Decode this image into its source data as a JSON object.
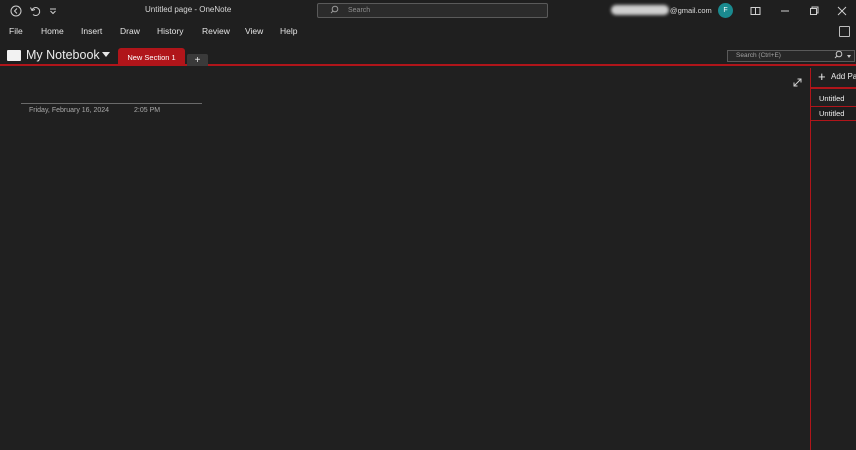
{
  "window": {
    "title": "Untitled page  -  OneNote",
    "search_placeholder": "Search",
    "account_suffix": "@gmail.com",
    "avatar_initial": "F",
    "icons": [
      "back-icon",
      "undo-icon",
      "quick-access-icon",
      "search-icon",
      "reading-mode-icon",
      "minimize-icon",
      "restore-icon",
      "close-icon"
    ]
  },
  "menu": {
    "items": [
      "File",
      "Home",
      "Insert",
      "Draw",
      "History",
      "Review",
      "View",
      "Help"
    ]
  },
  "notebook": {
    "name": "My Notebook",
    "section_tab": "New Section 1",
    "add_section": "+",
    "search_placeholder": "Search (Ctrl+E)"
  },
  "page": {
    "date": "Friday, February 16, 2024",
    "time": "2:05 PM"
  },
  "pages_pane": {
    "add_page_label": "Add Page",
    "pages": [
      "Untitled",
      "Untitled"
    ]
  },
  "colors": {
    "accent": "#b0151a",
    "background": "#202020",
    "avatar": "#1a8a8f"
  }
}
